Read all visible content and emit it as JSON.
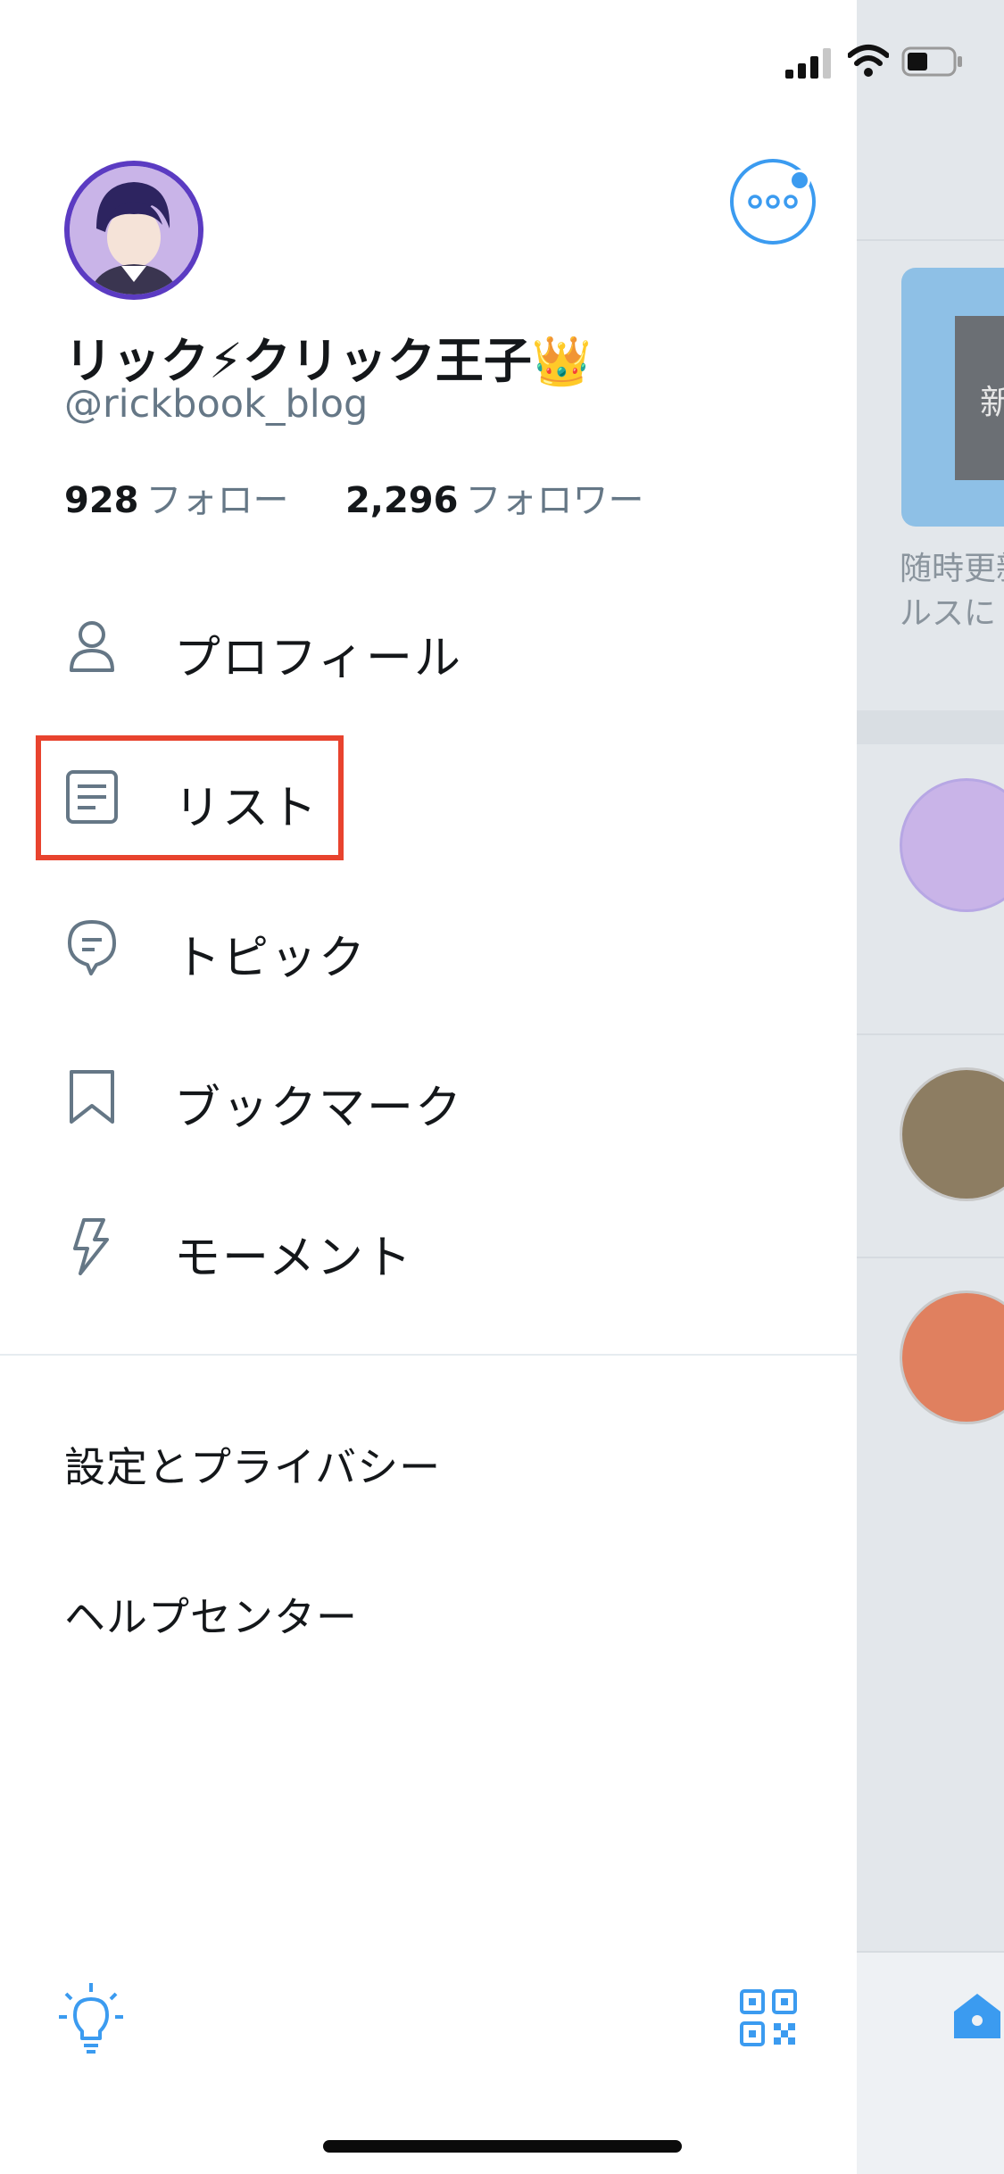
{
  "profile": {
    "name": "リック⚡クリック王子👑",
    "handle": "@rickbook_blog",
    "following_count": "928",
    "following_label": "フォロー",
    "followers_count": "2,296",
    "followers_label": "フォロワー"
  },
  "menu": {
    "items": [
      {
        "label": "プロフィール",
        "icon": "person-icon"
      },
      {
        "label": "リスト",
        "icon": "list-icon"
      },
      {
        "label": "トピック",
        "icon": "topic-icon"
      },
      {
        "label": "ブックマーク",
        "icon": "bookmark-icon"
      },
      {
        "label": "モーメント",
        "icon": "lightning-icon"
      }
    ],
    "secondary": [
      {
        "label": "設定とプライバシー"
      },
      {
        "label": "ヘルプセンター"
      }
    ]
  },
  "background_feed": {
    "card_overlay_text": "新",
    "snippet_lines": [
      "随時更新",
      "ルスに"
    ]
  },
  "colors": {
    "accent": "#3b9bf0",
    "highlight_border": "#e8432e",
    "secondary_text": "#657786"
  }
}
